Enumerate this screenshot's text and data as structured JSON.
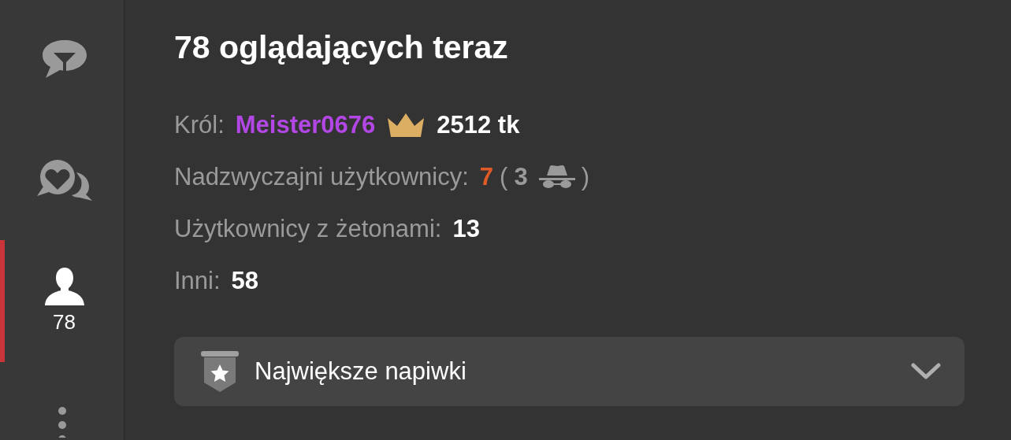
{
  "sidebar": {
    "tabs": [
      {
        "kind": "filter-chat",
        "selected": false
      },
      {
        "kind": "heart-chat",
        "selected": false
      },
      {
        "kind": "users",
        "count": "78",
        "selected": true
      }
    ]
  },
  "title": "78 oglądających teraz",
  "king": {
    "label": "Król:",
    "username": "Meister0676",
    "amount": "2512 tk"
  },
  "special": {
    "label": "Nadzwyczajni użytkownicy:",
    "count": "7",
    "open": "(",
    "hidden": "3",
    "close": ")"
  },
  "stats": [
    {
      "label": "Użytkownicy z żetonami:",
      "value": "13"
    },
    {
      "label": "Inni:",
      "value": "58"
    }
  ],
  "top_tips": {
    "label": "Największe napiwki",
    "expanded": false
  }
}
